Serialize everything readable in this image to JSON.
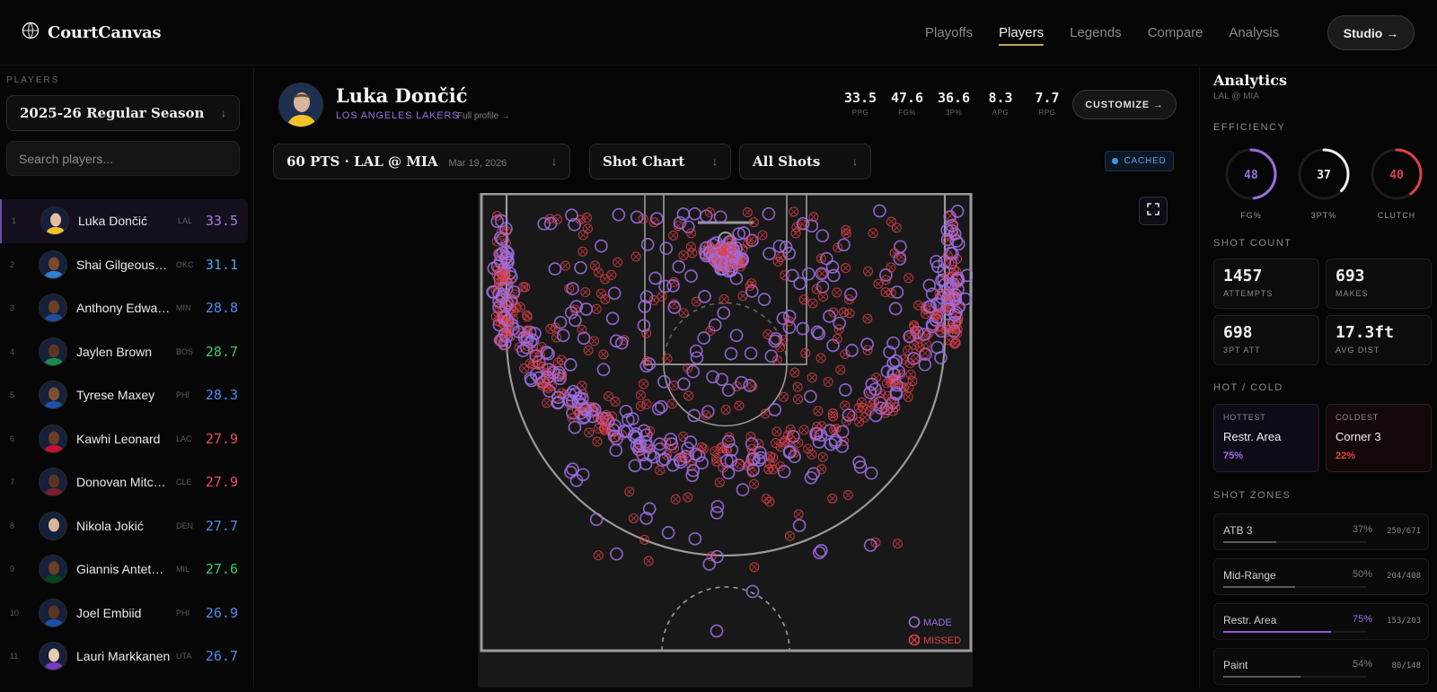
{
  "app": {
    "brand": "CourtCanvas"
  },
  "nav": {
    "items": [
      "Playoffs",
      "Players",
      "Legends",
      "Compare",
      "Analysis"
    ],
    "active": "Players",
    "studio": "Studio →"
  },
  "sidebar": {
    "label": "PLAYERS",
    "season": "2025-26 Regular Season",
    "search_placeholder": "Search players...",
    "players": [
      {
        "rank": "1",
        "name": "Luka Dončić",
        "team": "LAL",
        "ppg": "33.5",
        "color": "#a77de8"
      },
      {
        "rank": "2",
        "name": "Shai Gilgeous-Alexander",
        "team": "OKC",
        "ppg": "31.1",
        "color": "#3ea8f0"
      },
      {
        "rank": "3",
        "name": "Anthony Edwards",
        "team": "MIN",
        "ppg": "28.8",
        "color": "#4a8cf0"
      },
      {
        "rank": "4",
        "name": "Jaylen Brown",
        "team": "BOS",
        "ppg": "28.7",
        "color": "#2fd06a"
      },
      {
        "rank": "5",
        "name": "Tyrese Maxey",
        "team": "PHI",
        "ppg": "28.3",
        "color": "#4a8cf0"
      },
      {
        "rank": "6",
        "name": "Kawhi Leonard",
        "team": "LAC",
        "ppg": "27.9",
        "color": "#f04a5e"
      },
      {
        "rank": "7",
        "name": "Donovan Mitchell",
        "team": "CLE",
        "ppg": "27.9",
        "color": "#f04a6a"
      },
      {
        "rank": "8",
        "name": "Nikola Jokić",
        "team": "DEN",
        "ppg": "27.7",
        "color": "#4a8cf0"
      },
      {
        "rank": "9",
        "name": "Giannis Antetokounmpo",
        "team": "MIL",
        "ppg": "27.6",
        "color": "#2fd06a"
      },
      {
        "rank": "10",
        "name": "Joel Embiid",
        "team": "PHI",
        "ppg": "26.9",
        "color": "#4a8cf0"
      },
      {
        "rank": "11",
        "name": "Lauri Markkanen",
        "team": "UTA",
        "ppg": "26.7",
        "color": "#4a8cf0"
      }
    ]
  },
  "player": {
    "name": "Luka Dončić",
    "team": "LOS ANGELES LAKERS",
    "profile_link": "Full profile →",
    "stats": [
      {
        "value": "33.5",
        "label": "PPG"
      },
      {
        "value": "47.6",
        "label": "FG%"
      },
      {
        "value": "36.6",
        "label": "3P%"
      },
      {
        "value": "8.3",
        "label": "APG"
      },
      {
        "value": "7.7",
        "label": "RPG"
      }
    ],
    "customize": "CUSTOMIZE →"
  },
  "filters": {
    "game": "60 PTS · LAL @ MIA",
    "game_date": "Mar 19, 2026",
    "view": "Shot Chart",
    "shots": "All Shots",
    "cached": "CACHED"
  },
  "court": {
    "legend_made": "MADE",
    "legend_missed": "MISSED",
    "made_color": "#9b6ee0",
    "missed_color": "#e0404a"
  },
  "analytics": {
    "title": "Analytics",
    "subtitle": "LAL @ MIA",
    "efficiency_label": "EFFICIENCY",
    "gauges": [
      {
        "value": "48",
        "label": "FG%",
        "pct": 48,
        "color": "#9b6ee0"
      },
      {
        "value": "37",
        "label": "3PT%",
        "pct": 37,
        "color": "#f0f0f0"
      },
      {
        "value": "40",
        "label": "CLUTCH",
        "pct": 40,
        "color": "#e0404a"
      }
    ],
    "shot_count_label": "SHOT COUNT",
    "counts": [
      {
        "value": "1457",
        "label": "ATTEMPTS"
      },
      {
        "value": "693",
        "label": "MAKES"
      },
      {
        "value": "698",
        "label": "3PT ATT"
      },
      {
        "value": "17.3ft",
        "label": "AVG DIST"
      }
    ],
    "hotcold_label": "HOT / COLD",
    "hottest": {
      "label": "HOTTEST",
      "zone": "Restr. Area",
      "pct": "75%"
    },
    "coldest": {
      "label": "COLDEST",
      "zone": "Corner 3",
      "pct": "22%"
    },
    "zones_label": "SHOT ZONES",
    "zones": [
      {
        "name": "ATB 3",
        "pct": "37%",
        "count": "250/671",
        "fill": 37
      },
      {
        "name": "Mid-Range",
        "pct": "50%",
        "count": "204/408",
        "fill": 50
      },
      {
        "name": "Restr. Area",
        "pct": "75%",
        "count": "153/203",
        "fill": 75,
        "highlight": true
      },
      {
        "name": "Paint",
        "pct": "54%",
        "count": "80/148",
        "fill": 54
      }
    ]
  }
}
